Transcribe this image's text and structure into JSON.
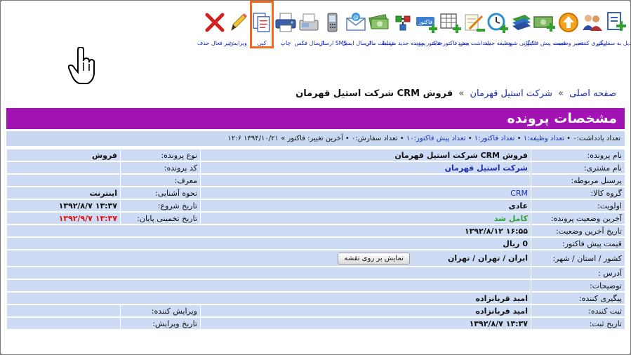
{
  "toolbar": {
    "items": [
      {
        "label": "تبدیل به سفارش",
        "icon": "add-doc-icon"
      },
      {
        "label": "پیگیری کننده",
        "icon": "users-icon"
      },
      {
        "label": "تغییر وضعیت",
        "icon": "up-arrow-icon"
      },
      {
        "label": "قیمت پیش فاکتور",
        "icon": "money-plus-icon"
      },
      {
        "label": "بایگانی شود",
        "icon": "books-icon"
      },
      {
        "label": "وظیفه جدید",
        "icon": "clock-plus-icon"
      },
      {
        "label": "یادداشت جدید",
        "icon": "note-pen-icon"
      },
      {
        "label": "پیش فاکتورجدید",
        "icon": "table-plus-icon"
      },
      {
        "label": "فاکتور جدید",
        "icon": "invoice-icon"
      },
      {
        "label": "پرونده جدید مرتبط",
        "icon": "link-icon"
      },
      {
        "label": "عملیات مالی",
        "icon": "money-icon"
      },
      {
        "label": "ارسال ایمیل",
        "icon": "email-icon"
      },
      {
        "label": "ارسال SMS",
        "icon": "mobile-icon"
      },
      {
        "label": "ارسال فکس",
        "icon": "fax-icon"
      },
      {
        "label": "چاپ",
        "icon": "printer-icon"
      },
      {
        "label": "کپی",
        "icon": "copy-icon"
      },
      {
        "label": "ویرایش",
        "icon": "pencil-icon"
      },
      {
        "label": "غیر فعال حذف",
        "icon": "delete-x-icon"
      }
    ],
    "invoice_icon_text": "فاکتور"
  },
  "breadcrumb": {
    "home": "صفحه اصلی",
    "sep1": "»",
    "customer": "شرکت استیل قهرمان",
    "sep2": "»",
    "current": "فروش CRM شرکت استیل قهرمان"
  },
  "banner": {
    "title": "مشخصات پرونده"
  },
  "stats": {
    "notes": "تعداد یادداشت:۰",
    "tasks": "تعداد وظیفه:۱",
    "invoices": "تعداد فاکتور:۱",
    "proformas": "تعداد پیش فاکتور:۱۰",
    "orders": "تعداد سفارش:۰",
    "last_change": "آخرین تغییر: فاکتور » ۱۳۹۴/۱۰/۲۱ ۱۲:۶",
    "sep": "•"
  },
  "fields": {
    "case_name": {
      "label": "نام پرونده:",
      "value": "فروش CRM شرکت استیل قهرمان"
    },
    "case_type": {
      "label": "نوع پرونده:",
      "value": "فروش"
    },
    "customer_name": {
      "label": "نام مشتری:",
      "value": "شرکت استیل قهرمان"
    },
    "case_code": {
      "label": "کد پرونده:",
      "value": ""
    },
    "related_staff": {
      "label": "پرسنل مربوطه:",
      "value": ""
    },
    "referrer": {
      "label": "معرف:",
      "value": ""
    },
    "product_group": {
      "label": "گروه کالا:",
      "value": "CRM"
    },
    "acquaintance": {
      "label": "نحوه آشنایی:",
      "value": "اینترنت"
    },
    "priority": {
      "label": "اولویت:",
      "value": "عادی"
    },
    "start_date": {
      "label": "تاریخ شروع:",
      "value": "۱۳:۳۷ ۱۳۹۲/۸/۷"
    },
    "last_status": {
      "label": "آخرین وضعیت پرونده:",
      "value": "کامل شد"
    },
    "end_estimate": {
      "label": "تاریخ تخمینی پایان:",
      "value": "۱۳:۳۷ ۱۳۹۲/۹/۷"
    },
    "last_status_date": {
      "label": "تاریخ آخرین وضعیت:",
      "value": "۱۶:۵۵ ۱۳۹۲/۸/۱۲"
    },
    "proforma_price": {
      "label": "قیمت پیش فاکتور:",
      "value": "0 ریال"
    },
    "location": {
      "label": "کشور / استان / شهر:",
      "value": "ایران / تهران / تهران",
      "button": "نمایش بر روی نقشه"
    },
    "address": {
      "label": "آدرس :",
      "value": ""
    },
    "description": {
      "label": "توضیحات:",
      "value": ""
    },
    "follower": {
      "label": "پیگیری کننده:",
      "value": "امید قربانزاده"
    },
    "registrar": {
      "label": "ثبت کننده:",
      "value": "امید قربانزاده"
    },
    "editor": {
      "label": "ویرایش کننده:",
      "value": ""
    },
    "register_date": {
      "label": "تاریخ ثبت:",
      "value": "۱۳:۳۷ ۱۳۹۲/۸/۷"
    },
    "edit_date": {
      "label": "تاریخ ویرایش:",
      "value": ""
    }
  }
}
